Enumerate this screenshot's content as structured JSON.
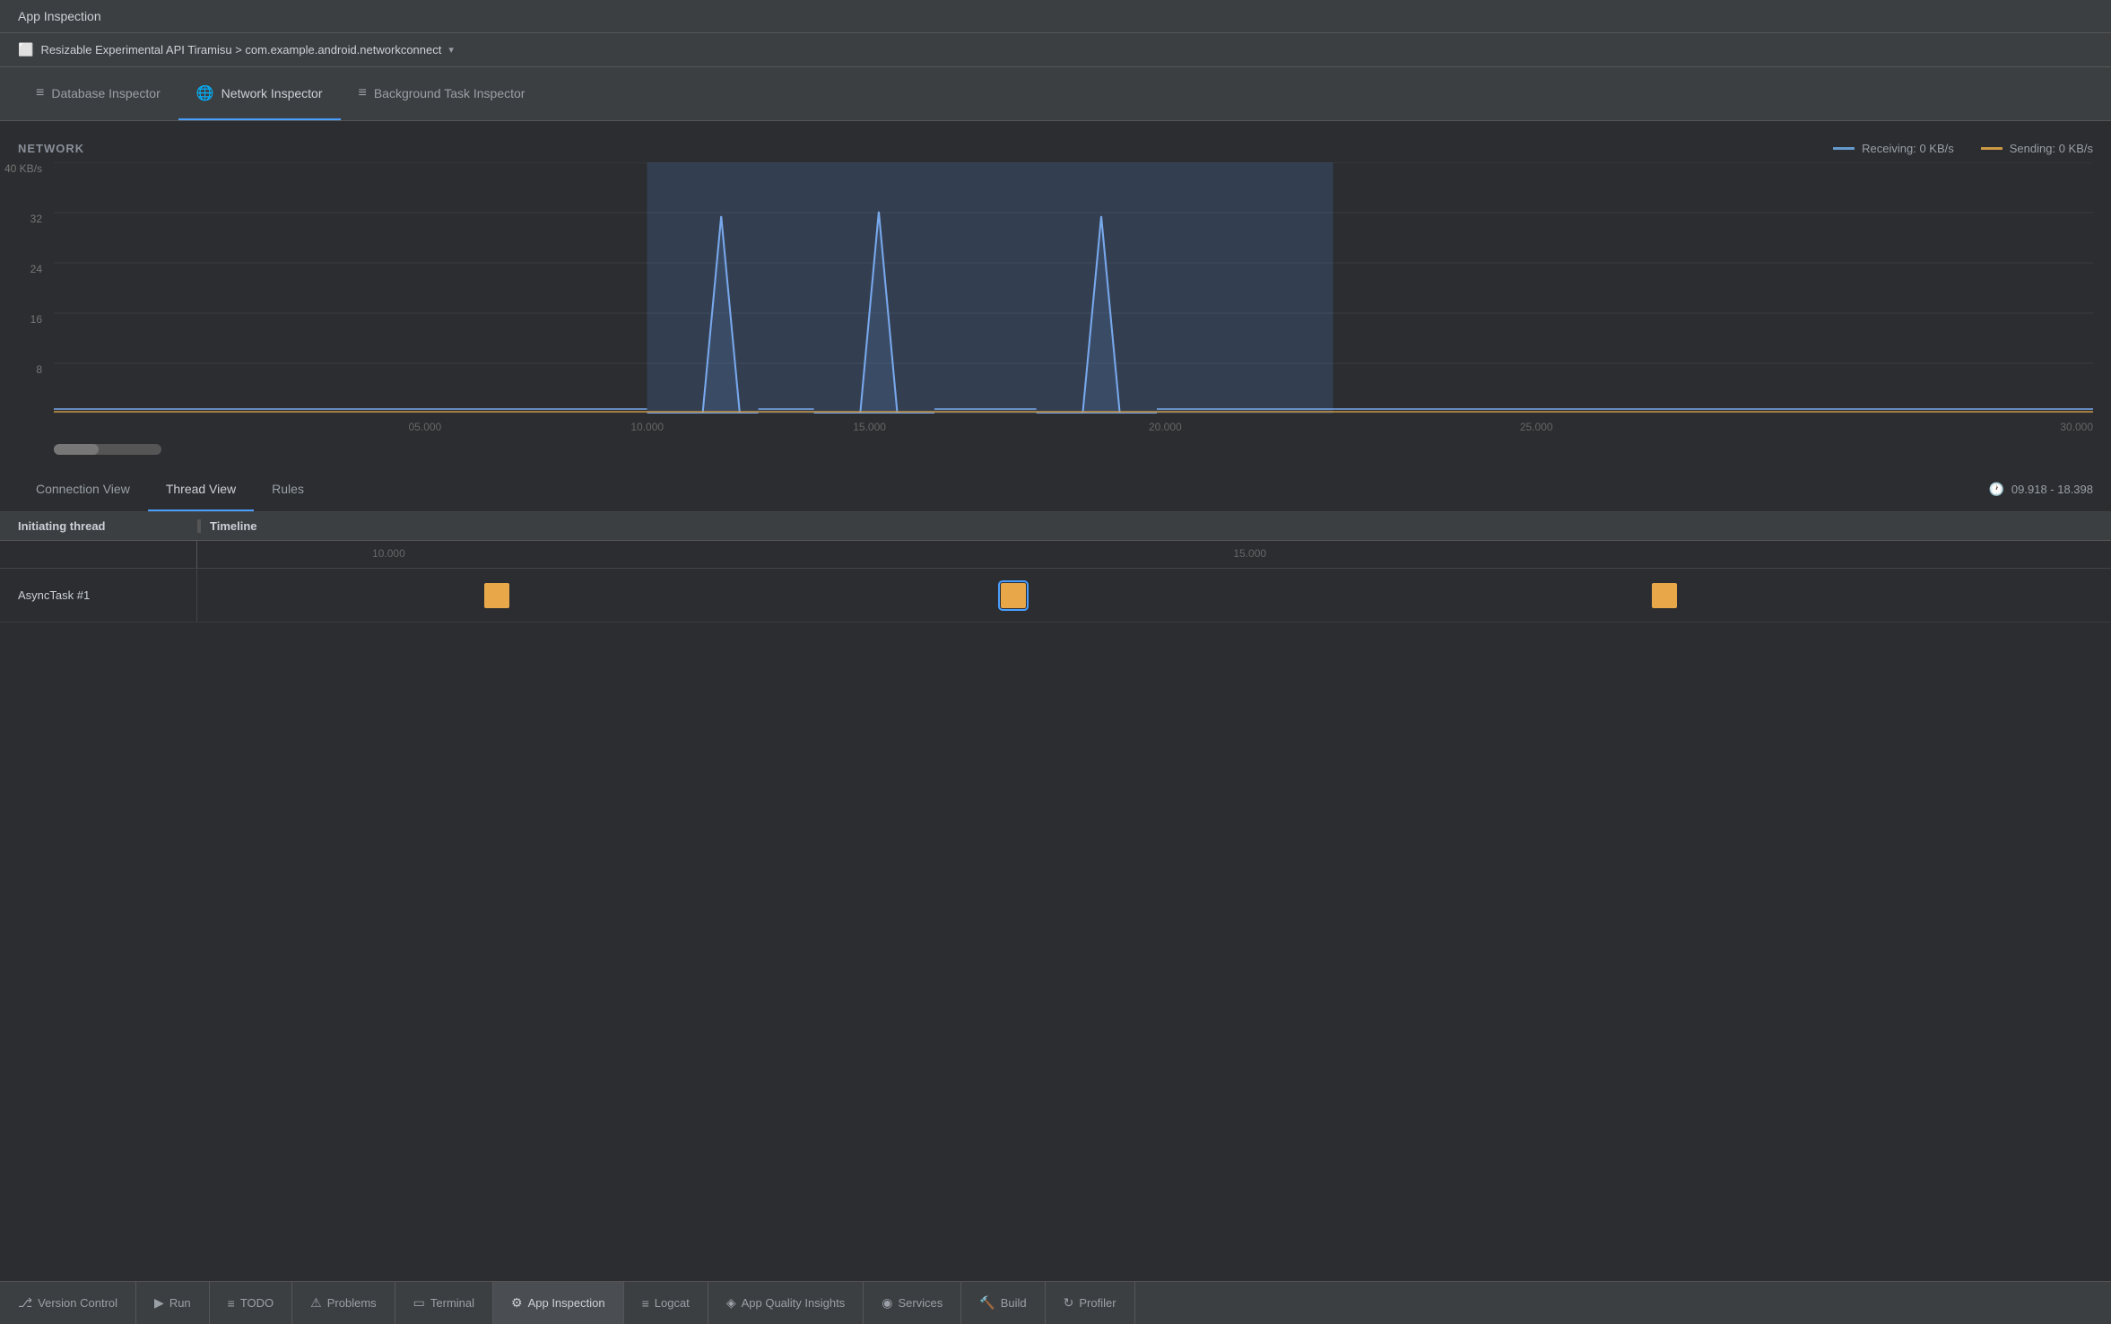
{
  "titleBar": {
    "label": "App Inspection"
  },
  "deviceBar": {
    "icon": "⬜",
    "label": "Resizable Experimental API Tiramisu > com.example.android.networkconnect",
    "arrow": "▾"
  },
  "inspectorTabs": [
    {
      "id": "database",
      "icon": "≡",
      "label": "Database Inspector",
      "active": false
    },
    {
      "id": "network",
      "icon": "🌐",
      "label": "Network Inspector",
      "active": true
    },
    {
      "id": "background",
      "icon": "≡",
      "label": "Background Task Inspector",
      "active": false
    }
  ],
  "networkChart": {
    "title": "NETWORK",
    "yAxis": [
      "40 KB/s",
      "32",
      "24",
      "16",
      "8",
      ""
    ],
    "xAxis": [
      "05.000",
      "10.000",
      "15.000",
      "20.000",
      "25.000",
      "30.000"
    ],
    "legend": {
      "receiving": "Receiving: 0 KB/s",
      "sending": "Sending: 0 KB/s"
    }
  },
  "viewTabs": [
    {
      "id": "connection",
      "label": "Connection View",
      "active": false
    },
    {
      "id": "thread",
      "label": "Thread View",
      "active": true
    },
    {
      "id": "rules",
      "label": "Rules",
      "active": false
    }
  ],
  "timeRange": "09.918 - 18.398",
  "tableHeader": {
    "thread": "Initiating thread",
    "timeline": "Timeline"
  },
  "timelineMarkers": [
    "10.000",
    "15.000"
  ],
  "tableRows": [
    {
      "thread": "AsyncTask #1",
      "tasks": [
        {
          "id": 1,
          "position": 17,
          "selected": false
        },
        {
          "id": 2,
          "position": 45,
          "selected": true
        },
        {
          "id": 3,
          "position": 78,
          "selected": false
        }
      ]
    }
  ],
  "bottomToolbar": [
    {
      "id": "version-control",
      "icon": "⎇",
      "label": "Version Control",
      "active": false
    },
    {
      "id": "run",
      "icon": "▶",
      "label": "Run",
      "active": false
    },
    {
      "id": "todo",
      "icon": "≡",
      "label": "TODO",
      "active": false
    },
    {
      "id": "problems",
      "icon": "⚠",
      "label": "Problems",
      "active": false
    },
    {
      "id": "terminal",
      "icon": "▭",
      "label": "Terminal",
      "active": false
    },
    {
      "id": "app-inspection",
      "icon": "⚙",
      "label": "App Inspection",
      "active": true
    },
    {
      "id": "logcat",
      "icon": "≡",
      "label": "Logcat",
      "active": false
    },
    {
      "id": "app-quality",
      "icon": "◈",
      "label": "App Quality Insights",
      "active": false
    },
    {
      "id": "services",
      "icon": "◉",
      "label": "Services",
      "active": false
    },
    {
      "id": "build",
      "icon": "🔨",
      "label": "Build",
      "active": false
    },
    {
      "id": "profiler",
      "icon": "↻",
      "label": "Profiler",
      "active": false
    }
  ]
}
